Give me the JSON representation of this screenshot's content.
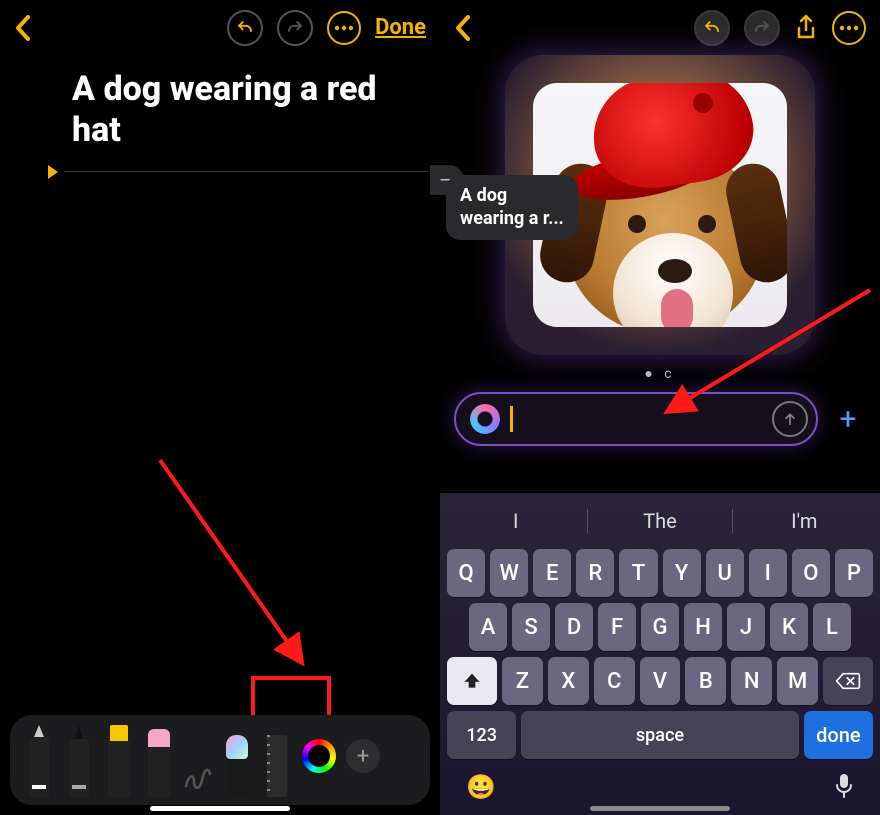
{
  "colors": {
    "accent": "#f7b100",
    "highlight_box": "#ff1a1a",
    "arrow": "#ff1a1a",
    "done_key": "#1e6fe0"
  },
  "left": {
    "nav": {
      "done_label": "Done"
    },
    "note_text": "A dog wearing a red hat",
    "tools": {
      "items": [
        "pen",
        "pencil",
        "highlighter",
        "eraser",
        "scribble",
        "image-wand",
        "ruler"
      ],
      "highlighted_tool": "image-wand"
    }
  },
  "right": {
    "caption": "A dog\nwearing a r...",
    "grab_label": "—",
    "pager": "●  c",
    "prompt": {
      "value": "",
      "placeholder": ""
    },
    "suggestions": [
      "I",
      "The",
      "I'm"
    ],
    "keyboard": {
      "row1": [
        "Q",
        "W",
        "E",
        "R",
        "T",
        "Y",
        "U",
        "I",
        "O",
        "P"
      ],
      "row2": [
        "A",
        "S",
        "D",
        "F",
        "G",
        "H",
        "J",
        "K",
        "L"
      ],
      "row3": [
        "Z",
        "X",
        "C",
        "V",
        "B",
        "N",
        "M"
      ],
      "numbers_label": "123",
      "space_label": "space",
      "done_label": "done"
    }
  }
}
